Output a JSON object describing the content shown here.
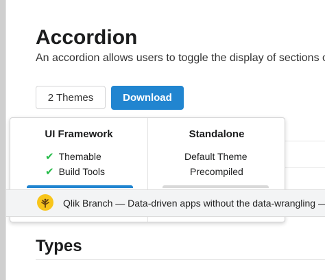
{
  "header": {
    "title": "Accordion",
    "subtitle": "An accordion allows users to toggle the display of sections of content"
  },
  "actions": {
    "themes_label": "2 Themes",
    "download_label": "Download"
  },
  "download_menu": {
    "columns": [
      {
        "title": "UI Framework",
        "features": [
          "Themable",
          "Build Tools"
        ]
      },
      {
        "title": "Standalone",
        "features": [
          "Default Theme",
          "Precompiled"
        ]
      }
    ]
  },
  "ad": {
    "text": "Qlik Branch — Data-driven apps without the data-wrangling —"
  },
  "section": {
    "title": "Types"
  },
  "colors": {
    "primary": "#2185d0",
    "check": "#21ba45",
    "ad_logo": "#f8c51b"
  }
}
